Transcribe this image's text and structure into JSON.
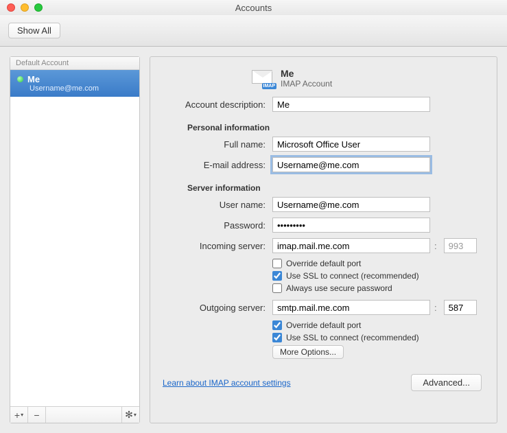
{
  "window": {
    "title": "Accounts"
  },
  "toolbar": {
    "show_all": "Show All"
  },
  "sidebar": {
    "header": "Default Account",
    "item": {
      "name": "Me",
      "email": "Username@me.com"
    },
    "footer": {
      "add": "+",
      "remove": "−",
      "gear": "✻"
    }
  },
  "acct": {
    "badge": "IMAP",
    "title": "Me",
    "subtitle": "IMAP Account"
  },
  "labels": {
    "description": "Account description:",
    "personal": "Personal information",
    "full_name": "Full name:",
    "email": "E-mail address:",
    "server_info": "Server information",
    "user_name": "User name:",
    "password": "Password:",
    "incoming": "Incoming server:",
    "outgoing": "Outgoing server:",
    "override": "Override default port",
    "ssl": "Use SSL to connect (recommended)",
    "secure_pw": "Always use secure password",
    "more_options": "More Options...",
    "learn_link": "Learn about IMAP account settings",
    "advanced": "Advanced..."
  },
  "values": {
    "description": "Me",
    "full_name": "Microsoft Office User",
    "email": "Username@me.com",
    "user_name": "Username@me.com",
    "password": "•••••••••",
    "incoming_server": "imap.mail.me.com",
    "incoming_port": "993",
    "outgoing_server": "smtp.mail.me.com",
    "outgoing_port": "587",
    "in_override": false,
    "in_ssl": true,
    "in_secure": false,
    "out_override": true,
    "out_ssl": true
  }
}
